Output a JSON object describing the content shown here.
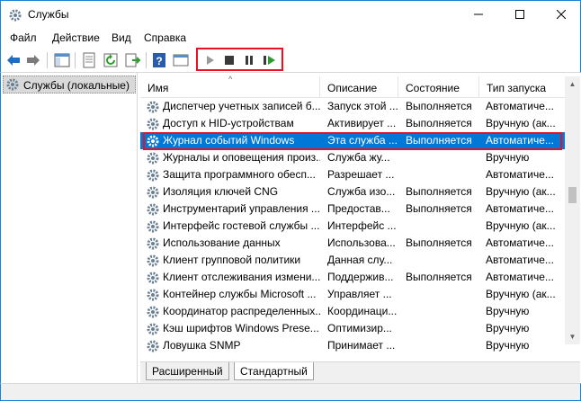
{
  "window": {
    "title": "Службы"
  },
  "menu": [
    "Файл",
    "Действие",
    "Вид",
    "Справка"
  ],
  "tree": {
    "root_label": "Службы (локальные)"
  },
  "columns": [
    "Имя",
    "Описание",
    "Состояние",
    "Тип запуска"
  ],
  "rows": [
    {
      "name": "Диспетчер учетных записей б...",
      "desc": "Запуск этой ...",
      "state": "Выполняется",
      "startup": "Автоматиче..."
    },
    {
      "name": "Доступ к HID-устройствам",
      "desc": "Активирует ...",
      "state": "Выполняется",
      "startup": "Вручную (ак..."
    },
    {
      "name": "Журнал событий Windows",
      "desc": "Эта служба ...",
      "state": "Выполняется",
      "startup": "Автоматиче...",
      "selected": true
    },
    {
      "name": "Журналы и оповещения произ...",
      "desc": "Служба жу...",
      "state": "",
      "startup": "Вручную"
    },
    {
      "name": "Защита программного обесп...",
      "desc": "Разрешает ...",
      "state": "",
      "startup": "Автоматиче..."
    },
    {
      "name": "Изоляция ключей CNG",
      "desc": "Служба изо...",
      "state": "Выполняется",
      "startup": "Вручную (ак..."
    },
    {
      "name": "Инструментарий управления ...",
      "desc": "Предостав...",
      "state": "Выполняется",
      "startup": "Автоматиче..."
    },
    {
      "name": "Интерфейс гостевой службы ...",
      "desc": "Интерфейс ...",
      "state": "",
      "startup": "Вручную (ак..."
    },
    {
      "name": "Использование данных",
      "desc": "Использова...",
      "state": "Выполняется",
      "startup": "Автоматиче..."
    },
    {
      "name": "Клиент групповой политики",
      "desc": "Данная слу...",
      "state": "",
      "startup": "Автоматиче..."
    },
    {
      "name": "Клиент отслеживания измени...",
      "desc": "Поддержив...",
      "state": "Выполняется",
      "startup": "Автоматиче..."
    },
    {
      "name": "Контейнер службы Microsoft ...",
      "desc": "Управляет ...",
      "state": "",
      "startup": "Вручную (ак..."
    },
    {
      "name": "Координатор распределенных...",
      "desc": "Координаци...",
      "state": "",
      "startup": "Вручную"
    },
    {
      "name": "Кэш шрифтов Windows Prese...",
      "desc": "Оптимизир...",
      "state": "",
      "startup": "Вручную"
    },
    {
      "name": "Ловушка SNMP",
      "desc": "Принимает ...",
      "state": "",
      "startup": "Вручную"
    }
  ],
  "tabs": [
    "Расширенный",
    "Стандартный"
  ],
  "colors": {
    "accent": "#0078d7",
    "highlight": "#e81123",
    "play": "#2d9c2d"
  },
  "toolbar_icons": [
    "back-icon",
    "forward-icon",
    "show-hide-tree-icon",
    "properties-icon",
    "refresh-icon",
    "export-icon",
    "help-icon",
    "console-view-icon",
    "play-icon",
    "stop-icon",
    "pause-icon",
    "restart-icon"
  ]
}
